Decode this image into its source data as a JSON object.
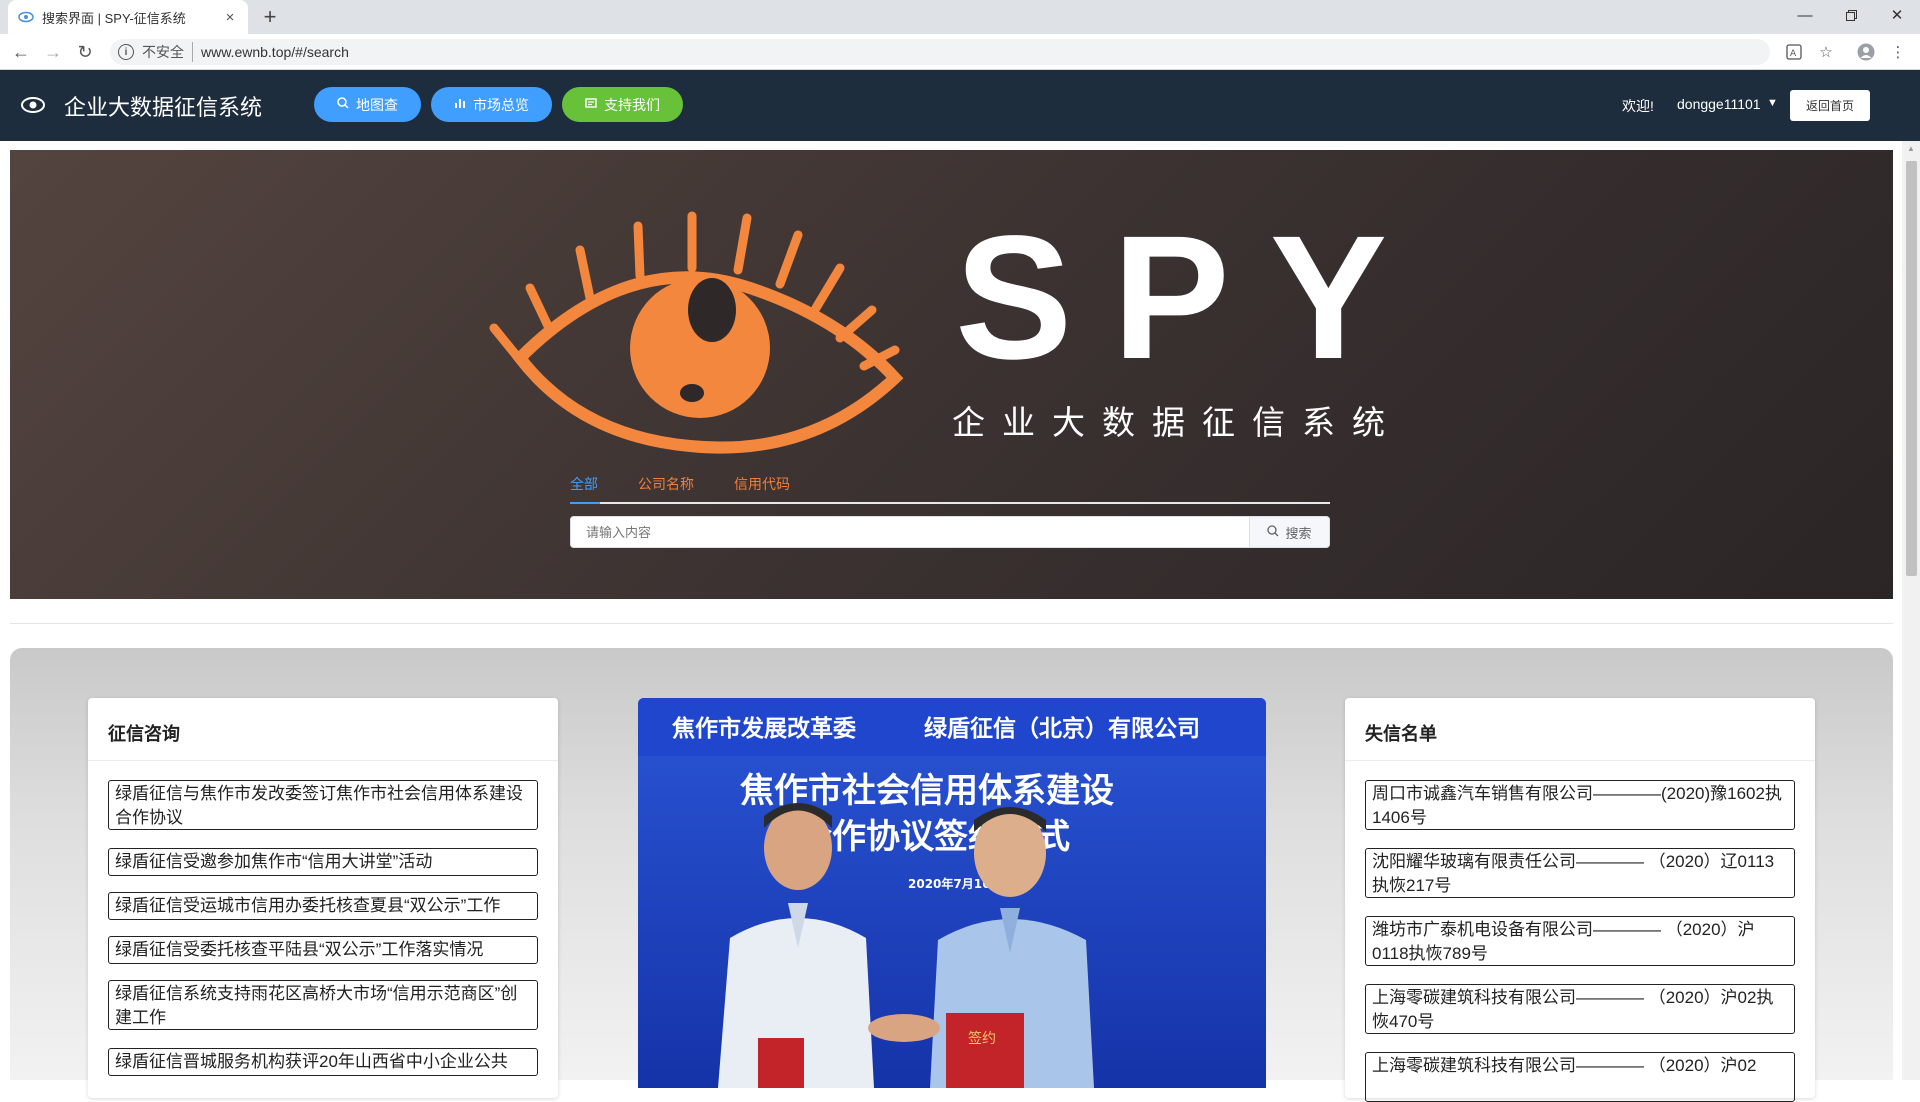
{
  "browser": {
    "tab_title": "搜索界面 | SPY-征信系统",
    "tab_close": "×",
    "new_tab": "+",
    "insecure_label": "不安全",
    "url": "www.ewnb.top/#/search"
  },
  "header": {
    "title": "企业大数据征信系统",
    "nav": [
      {
        "label": "地图查",
        "icon": "search-icon",
        "color": "#409eff"
      },
      {
        "label": "市场总览",
        "icon": "bar-chart-icon",
        "color": "#409eff"
      },
      {
        "label": "支持我们",
        "icon": "support-icon",
        "color": "#67c23a"
      }
    ],
    "welcome": "欢迎!",
    "username": "dongge11101",
    "home_button": "返回首页"
  },
  "hero": {
    "logo_text": "SPY",
    "subtitle": "企业大数据征信系统",
    "search_tabs": [
      "全部",
      "公司名称",
      "信用代码"
    ],
    "active_tab": "全部",
    "search_placeholder": "请输入内容",
    "search_button": "搜索",
    "accent_color": "#f4873e"
  },
  "consult": {
    "title": "征信咨询",
    "items": [
      "绿盾征信与焦作市发改委签订焦作市社会信用体系建设合作协议",
      "绿盾征信受邀参加焦作市“信用大讲堂”活动",
      "绿盾征信受运城市信用办委托核查夏县“双公示”工作",
      "绿盾征信受委托核查平陆县“双公示”工作落实情况",
      "绿盾征信系统支持雨花区高桥大市场“信用示范商区”创建工作",
      "绿盾征信晋城服务机构获评20年山西省中小企业公共"
    ]
  },
  "news_image": {
    "banner_left": "焦作市发展改革委",
    "banner_right": "绿盾征信（北京）有限公司",
    "headline_line1": "焦作市社会信用体系建设",
    "headline_line2": "合作协议签约仪式",
    "date": "2020年7月16日",
    "folder_text": "签约"
  },
  "blacklist": {
    "title": "失信名单",
    "items": [
      "周口市诚鑫汽车销售有限公司————(2020)豫1602执1406号",
      "沈阳耀华玻璃有限责任公司———— （2020）辽0113执恢217号",
      "潍坊市广泰机电设备有限公司———— （2020）沪0118执恢789号",
      "上海零碳建筑科技有限公司———— （2020）沪02执恢470号",
      "上海零碳建筑科技有限公司———— （2020）沪02"
    ]
  }
}
